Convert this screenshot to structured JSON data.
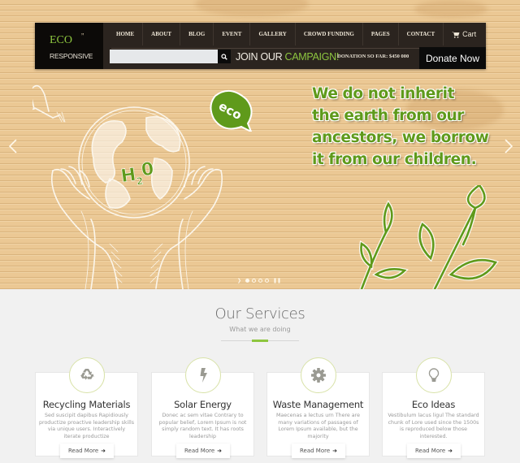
{
  "header": {
    "logo_title": "ECO",
    "logo_mark": "”",
    "logo_subtitle": "RESPONSIVE",
    "nav": [
      {
        "label": "HOME"
      },
      {
        "label": "ABOUT"
      },
      {
        "label": "BLOG"
      },
      {
        "label": "EVENT"
      },
      {
        "label": "GALLERY"
      },
      {
        "label": "CROWD FUNDING"
      },
      {
        "label": "PAGES"
      },
      {
        "label": "CONTACT"
      }
    ],
    "cart_label": "Cart",
    "cart_icon": "cart-icon",
    "search": {
      "value": "",
      "placeholder": "",
      "icon": "search-icon"
    },
    "campaign_prefix": "JOIN OUR",
    "campaign_highlight": "CAMPAIGN!",
    "donation_text": "DONATION SO FAR: $450 000",
    "donate_button": "Donate Now"
  },
  "hero": {
    "quote_lines": [
      "We do not inherit",
      "the earth from our",
      "ancestors, we borrow",
      "it from our children."
    ],
    "badge_text": "eco",
    "globe_label": "H2O",
    "prev_icon": "chevron-left-icon",
    "next_icon": "chevron-right-icon",
    "slides_count": 4,
    "active_slide": 1
  },
  "services": {
    "title": "Our Services",
    "subtitle": "What we are doing",
    "accent_color": "#8dc63f",
    "items": [
      {
        "icon": "recycle-icon",
        "title": "Recycling Materials",
        "text": "Sed suscipit dapibus Rapidiously productize proactive leadership skills via unique users. Interactively iterate productize",
        "button": "Read More"
      },
      {
        "icon": "lightning-bolt-icon",
        "title": "Solar Energy",
        "text": "Donec ac sem vitae Contrary to popular belief, Lorem Ipsum is not simply random text. It has roots leadership",
        "button": "Read More"
      },
      {
        "icon": "gear-icon",
        "title": "Waste Management",
        "text": "Maecenas a lectus urn There are many variations of passages of Lorem Ipsum available, but the majority",
        "button": "Read More"
      },
      {
        "icon": "lightbulb-icon",
        "title": "Eco Ideas",
        "text": "Vestibulum lacus ligul The standard chunk of Lore used since the 1500s is reproduced below those interested.",
        "button": "Read More"
      }
    ]
  }
}
